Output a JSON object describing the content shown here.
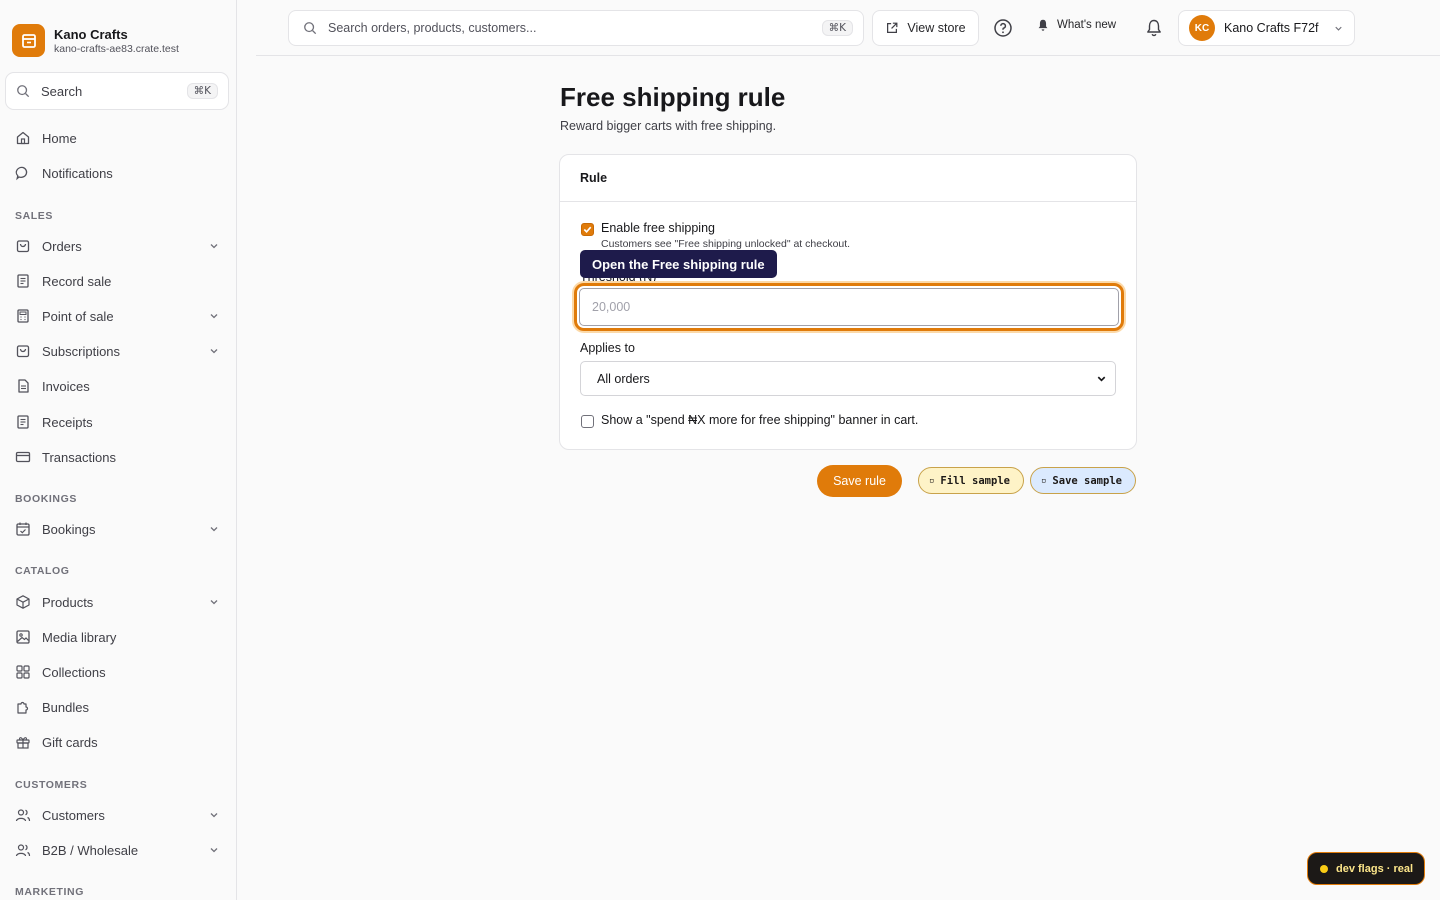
{
  "brand": {
    "name": "Kano Crafts",
    "url": "kano-crafts-ae83.crate.test"
  },
  "sidebar": {
    "search_label": "Search",
    "search_shortcut": "⌘K",
    "items": [
      {
        "label": "Home"
      },
      {
        "label": "Notifications"
      }
    ],
    "sections": [
      {
        "title": "SALES",
        "items": [
          {
            "label": "Orders",
            "expandable": true
          },
          {
            "label": "Record sale",
            "expandable": false
          },
          {
            "label": "Point of sale",
            "expandable": true
          },
          {
            "label": "Subscriptions",
            "expandable": true
          },
          {
            "label": "Invoices",
            "expandable": false
          },
          {
            "label": "Receipts",
            "expandable": false
          },
          {
            "label": "Transactions",
            "expandable": false
          }
        ]
      },
      {
        "title": "BOOKINGS",
        "items": [
          {
            "label": "Bookings",
            "expandable": true
          }
        ]
      },
      {
        "title": "CATALOG",
        "items": [
          {
            "label": "Products",
            "expandable": true
          },
          {
            "label": "Media library",
            "expandable": false
          },
          {
            "label": "Collections",
            "expandable": false
          },
          {
            "label": "Bundles",
            "expandable": false
          },
          {
            "label": "Gift cards",
            "expandable": false
          }
        ]
      },
      {
        "title": "CUSTOMERS",
        "items": [
          {
            "label": "Customers",
            "expandable": true
          },
          {
            "label": "B2B / Wholesale",
            "expandable": true
          }
        ]
      },
      {
        "title": "MARKETING",
        "items": []
      }
    ]
  },
  "topbar": {
    "search_placeholder": "Search orders, products, customers...",
    "search_shortcut": "⌘K",
    "view_store": "View store",
    "whats_new": "What's new",
    "account": {
      "initials": "KC",
      "name": "Kano Crafts F72f"
    }
  },
  "page": {
    "title": "Free shipping rule",
    "subtitle": "Reward bigger carts with free shipping."
  },
  "card": {
    "title": "Rule",
    "enable": {
      "label": "Enable free shipping",
      "help": "Customers see \"Free shipping unlocked\" at checkout.",
      "checked": true
    },
    "threshold": {
      "label": "Threshold (₦)",
      "placeholder": "20,000",
      "value": ""
    },
    "applies_to": {
      "label": "Applies to",
      "selected": "All orders"
    },
    "banner": {
      "label": "Show a \"spend ₦X more for free shipping\" banner in cart.",
      "checked": false
    }
  },
  "tooltip": "Open the Free shipping rule",
  "actions": {
    "save": "Save rule",
    "fill_sample": "Fill sample",
    "save_sample": "Save sample"
  },
  "devflags": "dev flags · real",
  "colors": {
    "accent": "#e07b0a",
    "tooltip_bg": "#1e1b4b"
  }
}
